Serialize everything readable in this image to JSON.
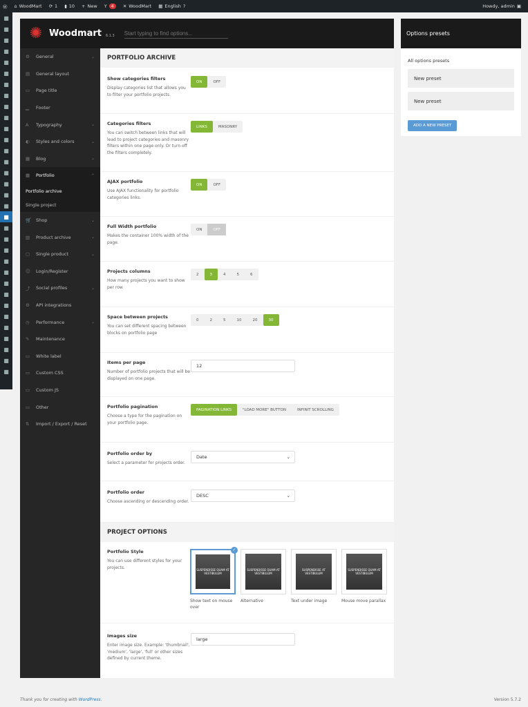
{
  "adminbar": {
    "site": "WoodMart",
    "updates": "1",
    "comments": "10",
    "new": "New",
    "seo_badge": "4",
    "theme": "WoodMart",
    "language": "English",
    "howdy": "Howdy, admin"
  },
  "header": {
    "brand": "Woodmart",
    "version": "6.1.3",
    "search_placeholder": "Start typing to find options..."
  },
  "nav": [
    {
      "label": "General",
      "icon": "gear",
      "chev": true
    },
    {
      "label": "General layout",
      "icon": "layout"
    },
    {
      "label": "Page title",
      "icon": "title"
    },
    {
      "label": "Footer",
      "icon": "footer"
    },
    {
      "label": "Typography",
      "icon": "type",
      "chev": true
    },
    {
      "label": "Styles and colors",
      "icon": "palette",
      "chev": true
    },
    {
      "label": "Blog",
      "icon": "blog",
      "chev": true
    },
    {
      "label": "Portfolio",
      "icon": "grid",
      "chev": true,
      "active": true
    }
  ],
  "nav_sub": [
    "Portfolio archive",
    "Single project"
  ],
  "nav2": [
    {
      "label": "Shop",
      "icon": "cart",
      "chev": true
    },
    {
      "label": "Product archive",
      "icon": "archive",
      "chev": true
    },
    {
      "label": "Single product",
      "icon": "product",
      "chev": true
    },
    {
      "label": "Login/Register",
      "icon": "user"
    },
    {
      "label": "Social profiles",
      "icon": "share",
      "chev": true
    },
    {
      "label": "API integrations",
      "icon": "api"
    },
    {
      "label": "Performance",
      "icon": "speed",
      "chev": true
    },
    {
      "label": "Maintenance",
      "icon": "wrench"
    },
    {
      "label": "White label",
      "icon": "label"
    },
    {
      "label": "Custom CSS",
      "icon": "css"
    },
    {
      "label": "Custom JS",
      "icon": "js"
    },
    {
      "label": "Other",
      "icon": "other"
    },
    {
      "label": "Import / Export / Reset",
      "icon": "import"
    }
  ],
  "section1": "PORTFOLIO ARCHIVE",
  "settings": {
    "show_filters": {
      "title": "Show categories filters",
      "desc": "Display categories list that allows you to filter your portfolio projects.",
      "options": [
        "ON",
        "OFF"
      ],
      "selected": "ON"
    },
    "filters": {
      "title": "Categories filters",
      "desc": "You can switch between links that will lead to project categories and masonry filters within one page only. Or turn off the filters completely.",
      "options": [
        "LINKS",
        "MASONRY"
      ],
      "selected": "LINKS"
    },
    "ajax": {
      "title": "AJAX portfolio",
      "desc": "Use AJAX functionality for portfolio categories links.",
      "options": [
        "ON",
        "OFF"
      ],
      "selected": "ON"
    },
    "full_width": {
      "title": "Full Width portfolio",
      "desc": "Makes the container 100% width of the page.",
      "options": [
        "ON",
        "OFF"
      ],
      "selected": "OFF"
    },
    "columns": {
      "title": "Projects columns",
      "desc": "How many projects you want to show per row",
      "options": [
        "2",
        "3",
        "4",
        "5",
        "6"
      ],
      "selected": "3"
    },
    "spacing": {
      "title": "Space between projects",
      "desc": "You can set different spacing between blocks on portfolio page",
      "options": [
        "0",
        "2",
        "5",
        "10",
        "20",
        "30"
      ],
      "selected": "30"
    },
    "per_page": {
      "title": "Items per page",
      "desc": "Number of portfolio projects that will be displayed on one page.",
      "value": "12"
    },
    "pagination": {
      "title": "Portfolio pagination",
      "desc": "Choose a type for the pagination on your portfolio page.",
      "options": [
        "PAGINATION LINKS",
        "\"LOAD MORE\" BUTTON",
        "INFINIT SCROLLING"
      ],
      "selected": "PAGINATION LINKS"
    },
    "order_by": {
      "title": "Portfolio order by",
      "desc": "Select a parameter for projects order.",
      "value": "Date"
    },
    "order": {
      "title": "Portfolio order",
      "desc": "Choose ascending or descending order.",
      "value": "DESC"
    }
  },
  "section2": "PROJECT OPTIONS",
  "style": {
    "title": "Portfolio Style",
    "desc": "You can use different styles for your projects.",
    "options": [
      {
        "caption": "Show text on mouse over",
        "img_text": "SUSPENDISSE QUAM AT VESTIBULUM",
        "selected": true
      },
      {
        "caption": "Alternative",
        "img_text": "SUSPENDISSE QUAM AT VESTIBULUM"
      },
      {
        "caption": "Text under image",
        "img_text": "SUSPENDISSE AT VESTIBULUM"
      },
      {
        "caption": "Mouse move parallax",
        "img_text": "SUSPENDISSE QUAM AT VESTIBULUM"
      }
    ]
  },
  "images_size": {
    "title": "Images size",
    "desc": "Enter image size. Example: 'thumbnail', 'medium', 'large', 'full' or other sizes defined by current theme.",
    "value": "large"
  },
  "presets": {
    "title": "Options presets",
    "all": "All options presets",
    "items": [
      "New preset",
      "New preset"
    ],
    "add": "ADD A NEW PRESET"
  },
  "footer": {
    "text": "Thank you for creating with ",
    "link": "WordPress",
    "suffix": ".",
    "version": "Version 5.7.2"
  },
  "colors": {
    "accent": "#83b735",
    "blue": "#5b9bd5"
  }
}
